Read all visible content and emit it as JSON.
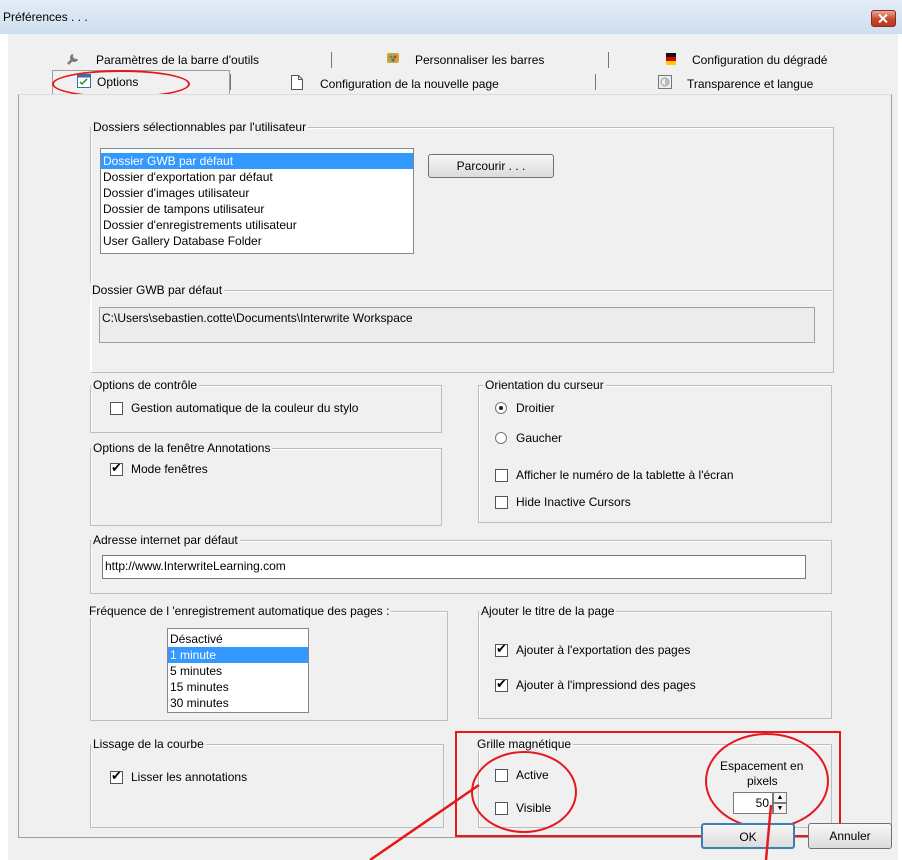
{
  "window": {
    "title": "Préférences . . ."
  },
  "tabs": {
    "row1": [
      "Paramètres de la barre d'outils",
      "Personnaliser les barres",
      "Configuration du dégradé"
    ],
    "row2": [
      "Options",
      "Configuration de la nouvelle page",
      "Transparence et langue"
    ]
  },
  "folders": {
    "group_label": "Dossiers sélectionnables par l'utilisateur",
    "items": [
      "Dossier GWB par défaut",
      "Dossier d'exportation par défaut",
      "Dossier d'images utilisateur",
      "Dossier de tampons utilisateur",
      "Dossier d'enregistrements utilisateur",
      "User Gallery Database Folder"
    ],
    "selected_index": 0,
    "browse_label": "Parcourir . . .",
    "path_label": "Dossier GWB par défaut",
    "path_value": "C:\\Users\\sebastien.cotte\\Documents\\Interwrite Workspace"
  },
  "control": {
    "group_label": "Options de contrôle",
    "auto_pen_label": "Gestion automatique de la couleur du stylo",
    "auto_pen_checked": false
  },
  "annotations_window": {
    "group_label": "Options de la fenêtre Annotations",
    "windowed_label": "Mode fenêtres",
    "windowed_checked": true
  },
  "cursor": {
    "group_label": "Orientation du curseur",
    "right_label": "Droitier",
    "left_label": "Gaucher",
    "selected": "Droitier",
    "show_tablet_label": "Afficher le numéro de la tablette à l'écran",
    "show_tablet_checked": false,
    "hide_inactive_label": "Hide Inactive Cursors",
    "hide_inactive_checked": false
  },
  "url": {
    "group_label": "Adresse internet par défaut",
    "value": "http://www.InterwriteLearning.com"
  },
  "autosave": {
    "group_label": "Fréquence de l 'enregistrement automatique des pages :",
    "items": [
      "Désactivé",
      "1 minute",
      "5 minutes",
      "15 minutes",
      "30 minutes"
    ],
    "selected_index": 1
  },
  "page_title": {
    "group_label": "Ajouter le titre de la page",
    "export_label": "Ajouter à l'exportation des pages",
    "export_checked": true,
    "print_label": "Ajouter à l'impressiond des pages",
    "print_checked": true
  },
  "smoothing": {
    "group_label": "Lissage de la courbe",
    "smooth_label": "Lisser les annotations",
    "smooth_checked": true
  },
  "grid": {
    "group_label": "Grille magnétique",
    "active_label": "Active",
    "active_checked": false,
    "visible_label": "Visible",
    "visible_checked": false,
    "spacing_label_1": "Espacement en",
    "spacing_label_2": "pixels",
    "spacing_value": "50"
  },
  "footer": {
    "ok_label": "OK",
    "cancel_label": "Annuler"
  },
  "colors": {
    "annotation": "#e5191c",
    "selection": "#3399ff"
  }
}
